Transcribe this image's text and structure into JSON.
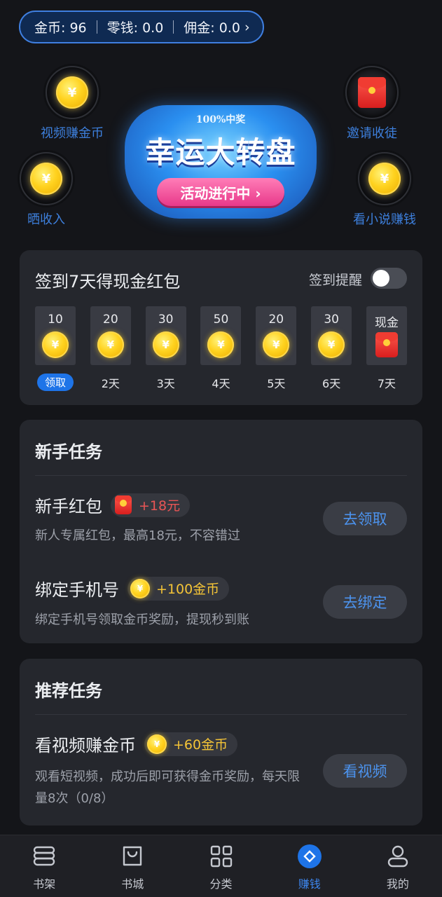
{
  "balance": {
    "coins": "金币: 96",
    "change": "零钱: 0.0",
    "commission": "佣金: 0.0",
    "chevron": "›"
  },
  "shortcuts": {
    "video_coins": "视频赚金币",
    "invite": "邀请收徒",
    "show_income": "晒收入",
    "read_earn": "看小说赚钱",
    "coin_symbol": "¥"
  },
  "banner": {
    "top_text": "100%中奖",
    "title": "幸运大转盘",
    "pill": "活动进行中 ›"
  },
  "signin": {
    "title": "签到7天得现金红包",
    "remind_label": "签到提醒",
    "remind_on": false,
    "days": [
      {
        "amount": "10",
        "label": "领取",
        "type": "coin",
        "active": true
      },
      {
        "amount": "20",
        "label": "2天",
        "type": "coin",
        "active": false
      },
      {
        "amount": "30",
        "label": "3天",
        "type": "coin",
        "active": false
      },
      {
        "amount": "50",
        "label": "4天",
        "type": "coin",
        "active": false
      },
      {
        "amount": "20",
        "label": "5天",
        "type": "coin",
        "active": false
      },
      {
        "amount": "30",
        "label": "6天",
        "type": "coin",
        "active": false
      },
      {
        "amount": "现金",
        "label": "7天",
        "type": "cash",
        "active": false
      }
    ]
  },
  "newbie": {
    "title": "新手任务",
    "tasks": [
      {
        "name": "新手红包",
        "reward": "+18元",
        "desc": "新人专属红包，最高18元，不容错过",
        "action": "去领取"
      },
      {
        "name": "绑定手机号",
        "reward": "+100金币",
        "desc": "绑定手机号领取金币奖励，提现秒到账",
        "action": "去绑定"
      }
    ]
  },
  "recommend": {
    "title": "推荐任务",
    "tasks": [
      {
        "name": "看视频赚金币",
        "reward": "+60金币",
        "desc": "观看短视频，成功后即可获得金币奖励，每天限量8次（0/8）",
        "action": "看视频"
      }
    ]
  },
  "nav": {
    "items": [
      {
        "label": "书架",
        "icon": "bookshelf-icon"
      },
      {
        "label": "书城",
        "icon": "bookstore-bag-icon"
      },
      {
        "label": "分类",
        "icon": "category-grid-icon"
      },
      {
        "label": "赚钱",
        "icon": "earn-money-icon",
        "active": true
      },
      {
        "label": "我的",
        "icon": "profile-icon"
      }
    ]
  },
  "colors": {
    "accent": "#1e74e8",
    "link": "#4c93ee",
    "gold": "#f4c437",
    "red": "#e95555",
    "background": "#141519",
    "card": "#25272d"
  }
}
